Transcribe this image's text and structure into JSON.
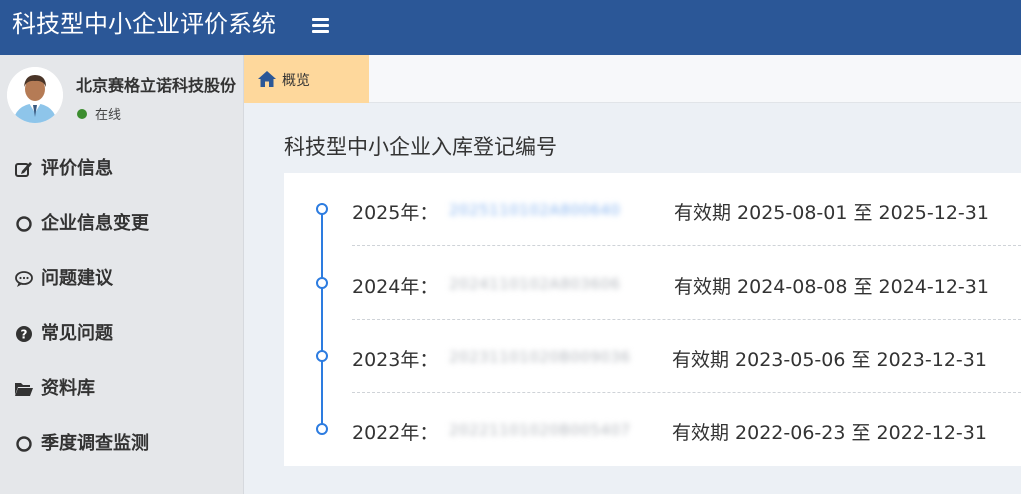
{
  "header": {
    "app_title": "科技型中小企业评价系统",
    "menu_icon": "hamburger-icon"
  },
  "user": {
    "company_name": "北京赛格立诺科技股份",
    "status": "在线",
    "status_color": "#3c8d2f"
  },
  "sidebar": {
    "items": [
      {
        "label": "评价信息",
        "icon": "edit-icon"
      },
      {
        "label": "企业信息变更",
        "icon": "circle-icon"
      },
      {
        "label": "问题建议",
        "icon": "comment-icon"
      },
      {
        "label": "常见问题",
        "icon": "question-circle-icon"
      },
      {
        "label": "资料库",
        "icon": "folder-open-icon"
      },
      {
        "label": "季度调查监测",
        "icon": "circle-icon"
      }
    ]
  },
  "tabs": [
    {
      "label": "概览",
      "icon": "home-icon",
      "active": true
    }
  ],
  "main": {
    "title": "科技型中小企业入库登记编号",
    "records": [
      {
        "year": "2025年：",
        "code": "2025110102A800640",
        "validity": "有效期 2025-08-01 至 2025-12-31"
      },
      {
        "year": "2024年：",
        "code": "2024110102A803606",
        "validity": "有效期 2024-08-08 至 2024-12-31"
      },
      {
        "year": "2023年：",
        "code": "20231101020B009036",
        "validity": "有效期 2023-05-06 至 2023-12-31"
      },
      {
        "year": "2022年：",
        "code": "20221101020B005407",
        "validity": "有效期 2022-06-23 至 2022-12-31"
      }
    ]
  },
  "colors": {
    "header_bg": "#2b5797",
    "tab_active_bg": "#fed89c",
    "timeline": "#2d7ce0",
    "code_text": "#8ab6f0",
    "code_text_muted": "#b5b9bf"
  }
}
